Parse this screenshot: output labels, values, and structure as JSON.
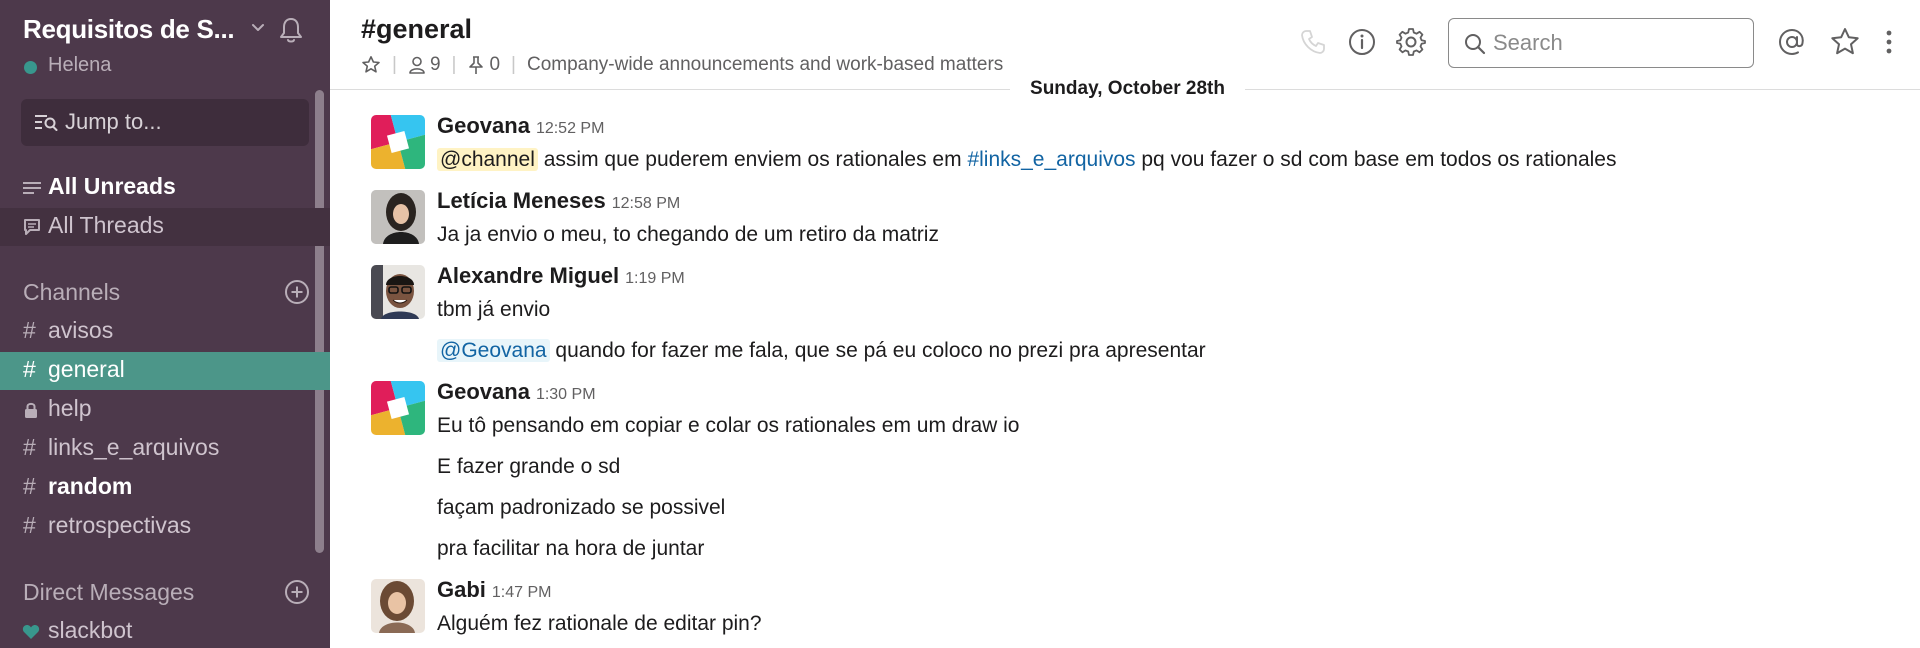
{
  "sidebar": {
    "team_name": "Requisitos de S...",
    "user_name": "Helena",
    "jump_label": "Jump to...",
    "all_unreads": "All Unreads",
    "all_threads": "All Threads",
    "channels_title": "Channels",
    "channels": [
      {
        "prefix": "#",
        "label": "avisos"
      },
      {
        "prefix": "#",
        "label": "general"
      },
      {
        "prefix": "lock",
        "label": "help"
      },
      {
        "prefix": "#",
        "label": "links_e_arquivos"
      },
      {
        "prefix": "#",
        "label": "random"
      },
      {
        "prefix": "#",
        "label": "retrospectivas"
      }
    ],
    "dm_title": "Direct Messages",
    "dms": [
      {
        "label": "slackbot"
      }
    ]
  },
  "header": {
    "channel_title": "#general",
    "member_count": "9",
    "pinned_count": "0",
    "topic": "Company-wide announcements and work-based matters",
    "search_placeholder": "Search"
  },
  "date_divider": "Sunday, October 28th",
  "messages": [
    {
      "author": "Geovana",
      "time": "12:52 PM",
      "lines": [
        {
          "mention": "@channel",
          "pre": " assim que puderem enviem os rationales em ",
          "link": "#links_e_arquivos",
          "post": " pq vou fazer o sd com base em todos os rationales"
        }
      ]
    },
    {
      "author": "Letícia Meneses",
      "time": "12:58 PM",
      "lines": [
        {
          "text": "Ja ja envio o meu, to chegando de um retiro da matriz"
        }
      ]
    },
    {
      "author": "Alexandre Miguel",
      "time": "1:19 PM",
      "lines": [
        {
          "text": "tbm já envio"
        },
        {
          "mention": "@Geovana",
          "text": " quando for fazer me fala, que se pá eu coloco no prezi pra apresentar"
        }
      ]
    },
    {
      "author": "Geovana",
      "time": "1:30 PM",
      "lines": [
        {
          "text": "Eu tô pensando em copiar e colar os rationales em um draw io"
        },
        {
          "text": "E fazer grande o sd"
        },
        {
          "text": "façam padronizado se possivel"
        },
        {
          "text": "pra facilitar  na hora de juntar"
        }
      ]
    },
    {
      "author": "Gabi",
      "time": "1:47 PM",
      "lines": [
        {
          "text": "Alguém fez rationale de editar pin?"
        }
      ]
    }
  ],
  "colors": {
    "sidebar_bg": "#4d394b",
    "active_channel": "#4c9689",
    "presence": "#38978d",
    "link": "#1264a3",
    "channel_mention_bg": "#fff3c4"
  }
}
